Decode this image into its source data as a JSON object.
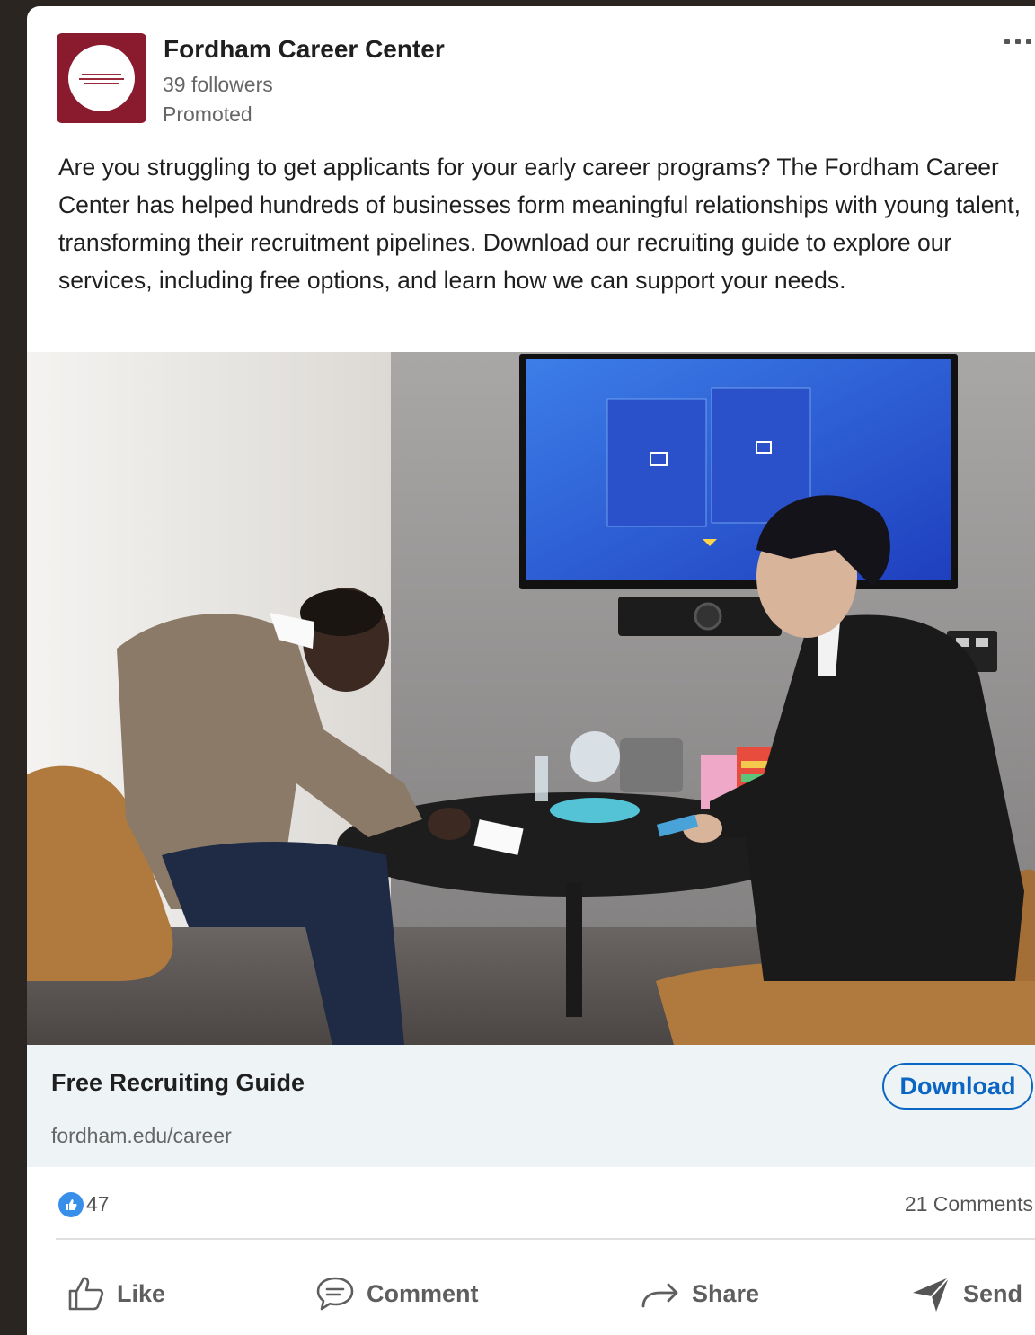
{
  "post": {
    "org_name": "Fordham Career Center",
    "followers": "39 followers",
    "promoted": "Promoted",
    "body": "Are you struggling to get applicants for your early career programs? The Fordham Career Center has helped hundreds of businesses form meaningful relationships with young talent, transforming their recruitment pipelines. Download our recruiting guide to explore our services, including free options, and learn how we can support your needs."
  },
  "icons": {
    "more": "more-horizontal-icon",
    "reaction": "thumbs-up-icon",
    "like": "thumbs-up-outline-icon",
    "comment": "speech-bubble-icon",
    "share": "arrow-right-icon",
    "send": "paper-plane-icon"
  },
  "link_card": {
    "title": "Free Recruiting Guide",
    "url": "fordham.edu/career",
    "cta_label": "Download"
  },
  "social": {
    "reactions": "47",
    "comments": "21 Comments"
  },
  "actions": {
    "like": "Like",
    "comment": "Comment",
    "share": "Share",
    "send": "Send"
  },
  "colors": {
    "brand_logo": "#8a1a2e",
    "link_blue": "#0a66c2",
    "reaction_blue": "#378fe9",
    "link_bar_bg": "#eef3f6"
  }
}
